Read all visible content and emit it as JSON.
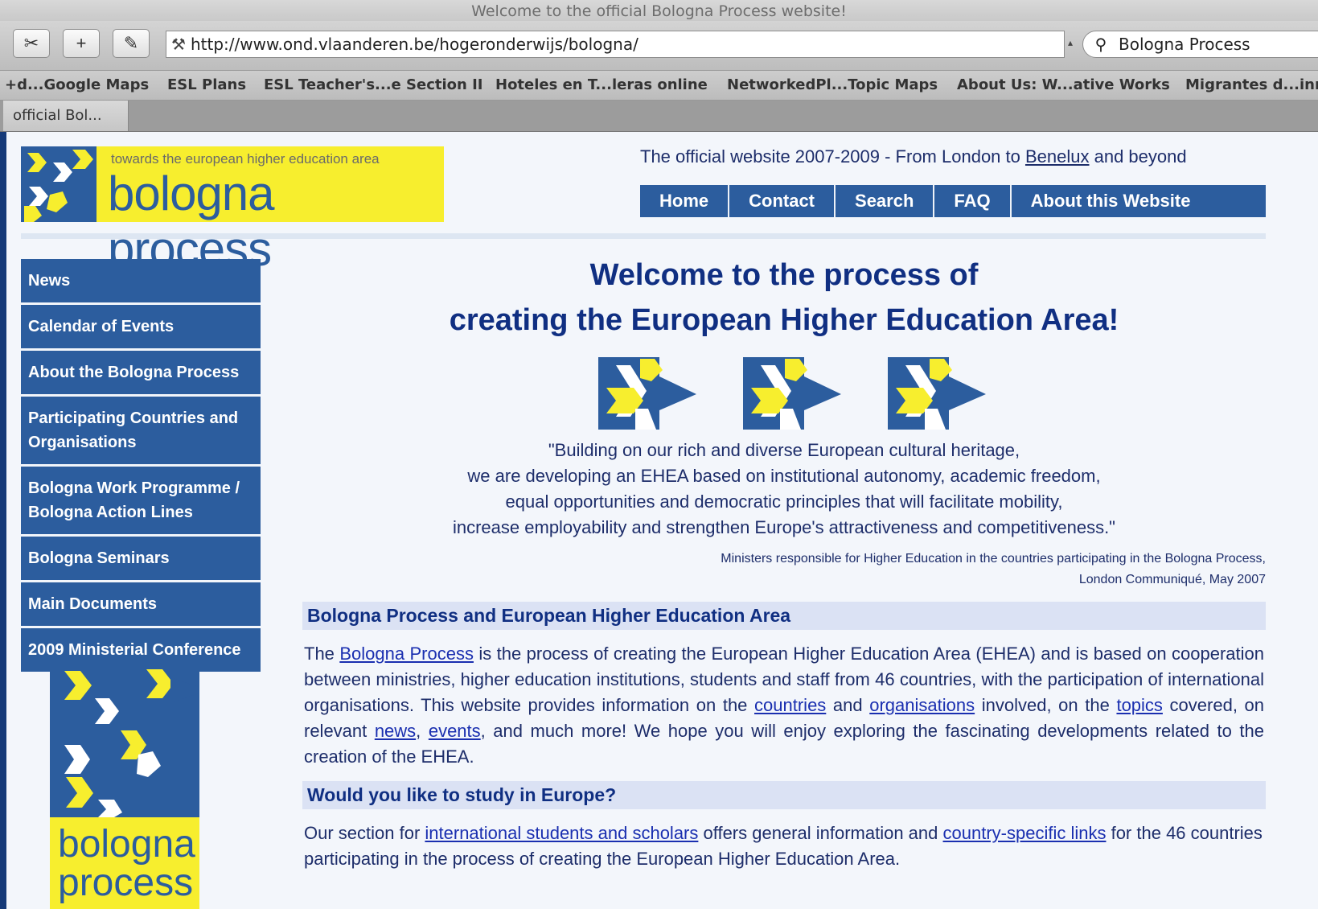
{
  "window": {
    "title": "Welcome to the official Bologna Process website!"
  },
  "toolbar": {
    "url": "http://www.ond.vlaanderen.be/hogeronderwijs/bologna/",
    "search_value": "Bologna Process"
  },
  "bookmarks": [
    "+d...Google Maps",
    "ESL Plans",
    "ESL Teacher's...e Section II",
    "Hoteles en T...leras online",
    "NetworkedPl...Topic Maps",
    "About Us: W...ative Works",
    "Migrantes d...inn"
  ],
  "tab": {
    "label": "official Bol..."
  },
  "logo": {
    "tagline": "towards the european higher education area",
    "name": "bologna process"
  },
  "header": {
    "tagline_before": "The official website 2007-2009 - From London to ",
    "tagline_link": "Benelux",
    "tagline_after": " and beyond"
  },
  "topnav": [
    "Home",
    "Contact",
    "Search",
    "FAQ",
    "About this Website"
  ],
  "sidenav": [
    "News",
    "Calendar of Events",
    "About the Bologna Process",
    "Participating Countries and Organisations",
    "Bologna Work Programme / Bologna Action Lines",
    "Bologna Seminars",
    "Main Documents",
    "2009 Ministerial Conference"
  ],
  "side_logo": {
    "line1": "bologna",
    "line2": "process"
  },
  "main": {
    "welcome_line1": "Welcome to the process of",
    "welcome_line2": "creating the European Higher Education Area!",
    "quote": [
      "\"Building on our rich and diverse European cultural heritage,",
      "we are developing an EHEA based on institutional autonomy, academic freedom,",
      "equal opportunities and democratic principles that will facilitate mobility,",
      "increase employability and strengthen Europe's attractiveness and competitiveness.\""
    ],
    "credit_line1": "Ministers responsible for Higher Education in the countries participating in the Bologna Process,",
    "credit_line2": "London Communiqué, May 2007",
    "section1_title": "Bologna Process and European Higher Education Area",
    "p1": {
      "t1": "The ",
      "l1": "Bologna Process",
      "t2": " is the process of creating the European Higher Education Area (EHEA) and is based on cooperation between ministries, higher education institutions, students and staff from 46 countries, with the participation of international organisations. This website provides information on the ",
      "l2": "countries",
      "t3": " and ",
      "l3": "organisations",
      "t4": " involved, on the ",
      "l4": "topics",
      "t5": " covered, on relevant ",
      "l5": "news",
      "t6": ", ",
      "l6": "events",
      "t7": ", and much more! We hope you will enjoy exploring the fascinating developments related to the creation of the EHEA."
    },
    "section2_title": "Would you like to study in Europe?",
    "p2": {
      "t1": "Our section for ",
      "l1": "international students and scholars",
      "t2": " offers general information and ",
      "l2": "country-specific links",
      "t3": " for the 46 countries participating in the process of creating the European Higher Education Area."
    }
  },
  "colors": {
    "nav_blue": "#2c5d9e",
    "logo_yellow": "#f7ee2e",
    "heading_blue": "#102f82"
  }
}
